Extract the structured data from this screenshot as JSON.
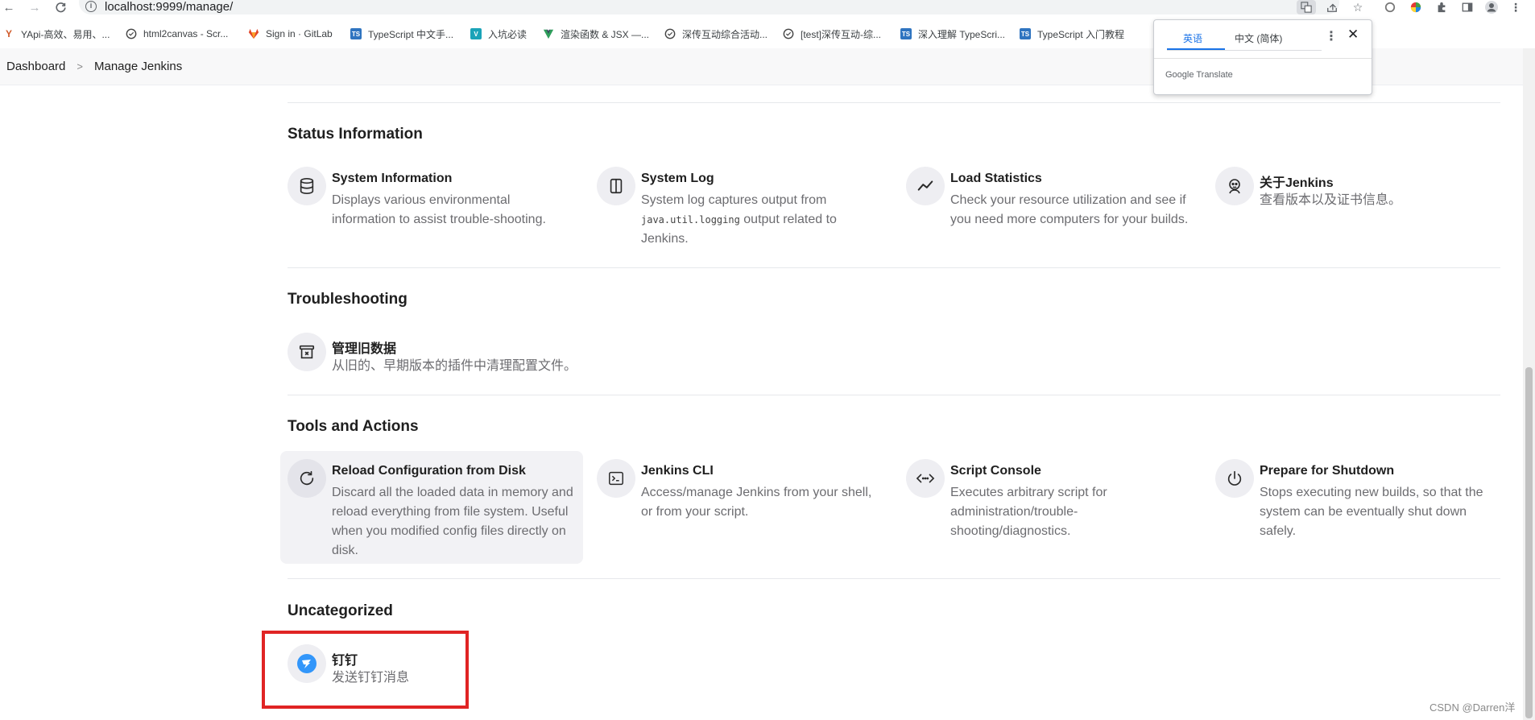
{
  "browser": {
    "url": "localhost:9999/manage/",
    "bookmarks": [
      {
        "label": "YApi-高效、易用、...",
        "icon": "yapi-icon",
        "color": "#d05a2a"
      },
      {
        "label": "html2canvas - Scr...",
        "icon": "globe-icon",
        "color": "#444"
      },
      {
        "label": "Sign in · GitLab",
        "icon": "gitlab-icon",
        "color": "#e24329"
      },
      {
        "label": "TypeScript 中文手...",
        "icon": "typescript-icon",
        "color": "#2f74c0"
      },
      {
        "label": "入坑必读",
        "icon": "vant-icon",
        "color": "#1aa3b8"
      },
      {
        "label": "渲染函数 & JSX —...",
        "icon": "vue-icon",
        "color": "#2f9e5b"
      },
      {
        "label": "深传互动综合活动...",
        "icon": "globe-icon",
        "color": "#444"
      },
      {
        "label": "[test]深传互动-综...",
        "icon": "globe-icon",
        "color": "#444"
      },
      {
        "label": "深入理解 TypeScri...",
        "icon": "typescript-icon",
        "color": "#2f74c0"
      },
      {
        "label": "TypeScript 入门教程",
        "icon": "typescript-icon",
        "color": "#2f74c0"
      }
    ]
  },
  "translate_popup": {
    "tab_source": "英语",
    "tab_target": "中文 (简体)",
    "brand_google": "Google",
    "brand_translate": "Translate"
  },
  "breadcrumb": {
    "root": "Dashboard",
    "current": "Manage Jenkins"
  },
  "sections": {
    "status": {
      "title": "Status Information",
      "items": [
        {
          "title": "System Information",
          "desc": "Displays various environmental information to assist trouble-shooting.",
          "icon": "database-icon"
        },
        {
          "title": "System Log",
          "desc_pre": "System log captures output from ",
          "desc_code": "java.util.logging",
          "desc_post": " output related to Jenkins.",
          "icon": "log-panel-icon"
        },
        {
          "title": "Load Statistics",
          "desc": "Check your resource utilization and see if you need more computers for your builds.",
          "icon": "line-chart-icon"
        },
        {
          "title": "关于Jenkins",
          "desc": "查看版本以及证书信息。",
          "icon": "jenkins-butler-icon"
        }
      ]
    },
    "troubleshooting": {
      "title": "Troubleshooting",
      "items": [
        {
          "title": "管理旧数据",
          "desc": "从旧的、早期版本的插件中清理配置文件。",
          "icon": "archive-x-icon"
        }
      ]
    },
    "tools": {
      "title": "Tools and Actions",
      "items": [
        {
          "title": "Reload Configuration from Disk",
          "desc": "Discard all the loaded data in memory and reload everything from file system. Useful when you modified config files directly on disk.",
          "icon": "reload-icon"
        },
        {
          "title": "Jenkins CLI",
          "desc": "Access/manage Jenkins from your shell, or from your script.",
          "icon": "terminal-icon"
        },
        {
          "title": "Script Console",
          "desc": "Executes arbitrary script for administration/trouble-shooting/diagnostics.",
          "icon": "code-icon"
        },
        {
          "title": "Prepare for Shutdown",
          "desc": "Stops executing new builds, so that the system can be eventually shut down safely.",
          "icon": "power-icon"
        }
      ]
    },
    "uncategorized": {
      "title": "Uncategorized",
      "items": [
        {
          "title": "钉钉",
          "desc": "发送钉钉消息",
          "icon": "dingtalk-icon",
          "color": "#3296fa"
        }
      ]
    }
  },
  "watermark": "CSDN @Darren洋"
}
